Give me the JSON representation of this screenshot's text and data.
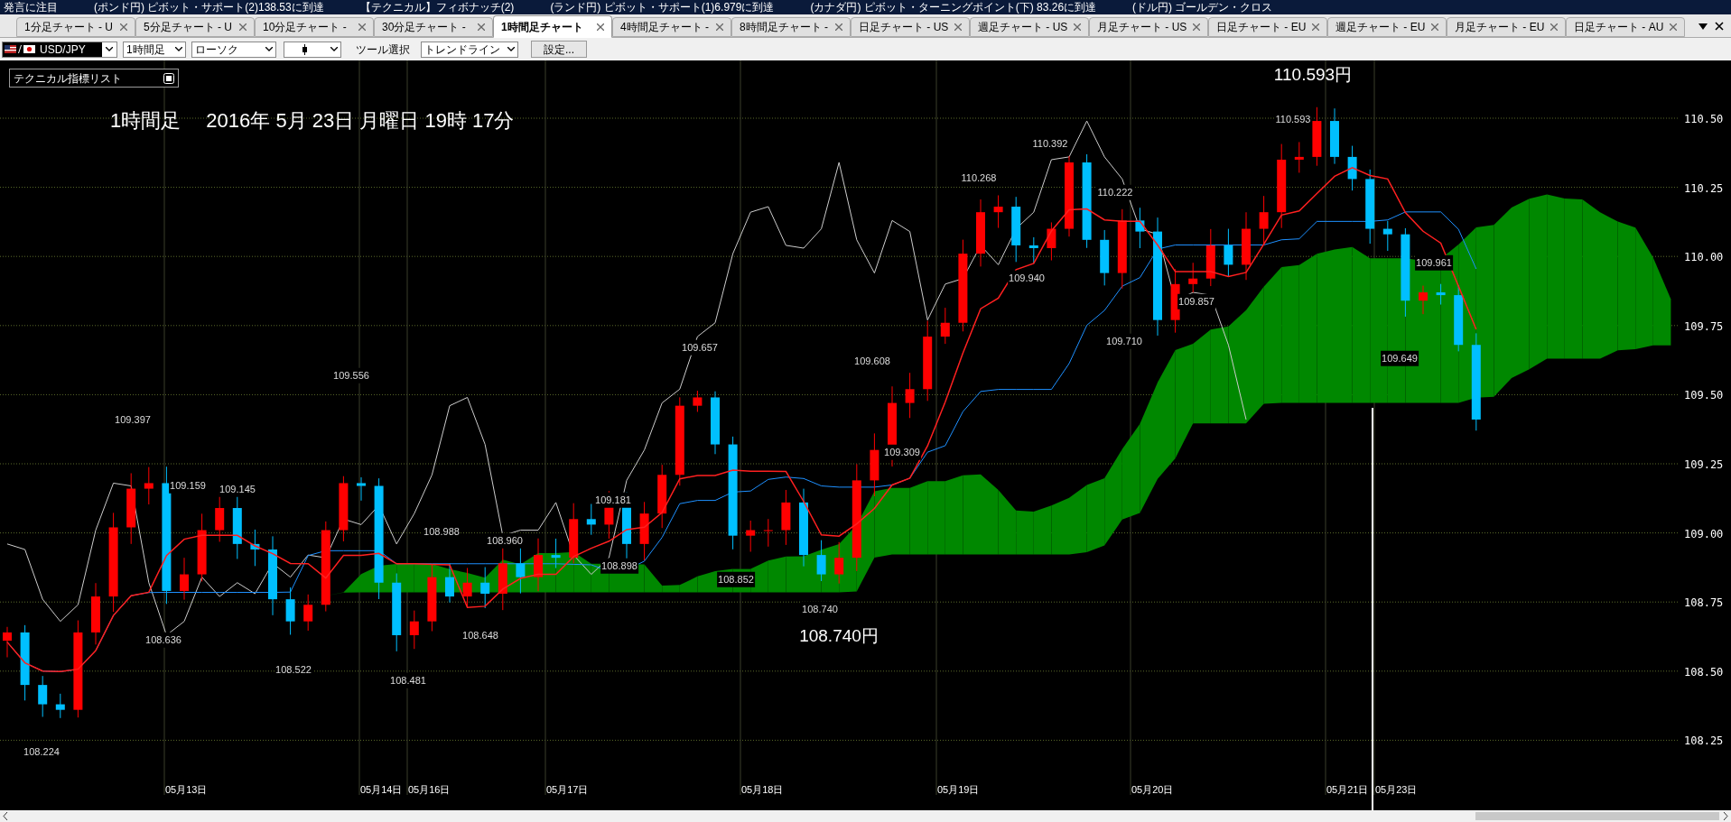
{
  "ticker": [
    {
      "text": "発言に注目"
    },
    {
      "text": "(ポンド円) ピボット・サポート(2)138.53に到達"
    },
    {
      "text": "【テクニカル】フィボナッチ(2)"
    },
    {
      "text": "(ランド円) ピボット・サポート(1)6.979に到達"
    },
    {
      "text": "(カナダ円) ピボット・ターニングポイント(下) 83.26に到達"
    },
    {
      "text": "(ドル円) ゴールデン・クロス"
    }
  ],
  "tabs": [
    {
      "label": "1分足チャート - U",
      "selected": false
    },
    {
      "label": "5分足チャート - U",
      "selected": false
    },
    {
      "label": "10分足チャート -",
      "selected": false
    },
    {
      "label": "30分足チャート -",
      "selected": false
    },
    {
      "label": "1時間足チャート",
      "selected": true
    },
    {
      "label": "4時間足チャート -",
      "selected": false
    },
    {
      "label": "8時間足チャート -",
      "selected": false
    },
    {
      "label": "日足チャート - US",
      "selected": false
    },
    {
      "label": "週足チャート - US",
      "selected": false
    },
    {
      "label": "月足チャート - US",
      "selected": false
    },
    {
      "label": "日足チャート - EU",
      "selected": false
    },
    {
      "label": "週足チャート - EU",
      "selected": false
    },
    {
      "label": "月足チャート - EU",
      "selected": false
    },
    {
      "label": "日足チャート - AU",
      "selected": false
    }
  ],
  "toolbar": {
    "pair": "USD/JPY",
    "timeframe": "1時間足",
    "chart_type": "ローソク",
    "tool_label": "ツール選択",
    "tool": "トレンドライン",
    "settings_button": "設定..."
  },
  "chart": {
    "indicator_list": "テクニカル指標リスト",
    "title": "1時間足　 2016年 5月 23日 月曜日 19時 17分",
    "high_label": "110.593円",
    "low_label": "108.740円",
    "price_labels": [
      "109.397",
      "109.159",
      "109.145",
      "109.556",
      "108.636",
      "108.522",
      "108.481",
      "108.648",
      "108.988",
      "108.960",
      "109.181",
      "108.898",
      "108.852",
      "109.657",
      "108.740",
      "109.608",
      "109.309",
      "110.268",
      "110.392",
      "109.940",
      "110.222",
      "109.710",
      "109.857",
      "110.593",
      "109.961",
      "109.649",
      "108.224"
    ],
    "price_axis": [
      "110.50",
      "110.25",
      "110.00",
      "109.75",
      "109.50",
      "109.25",
      "109.00",
      "108.75",
      "108.50",
      "108.25"
    ],
    "date_axis": [
      "05月13日",
      "05月14日",
      "05月16日",
      "05月17日",
      "05月18日",
      "05月19日",
      "05月20日",
      "05月21日",
      "05月23日"
    ]
  }
}
